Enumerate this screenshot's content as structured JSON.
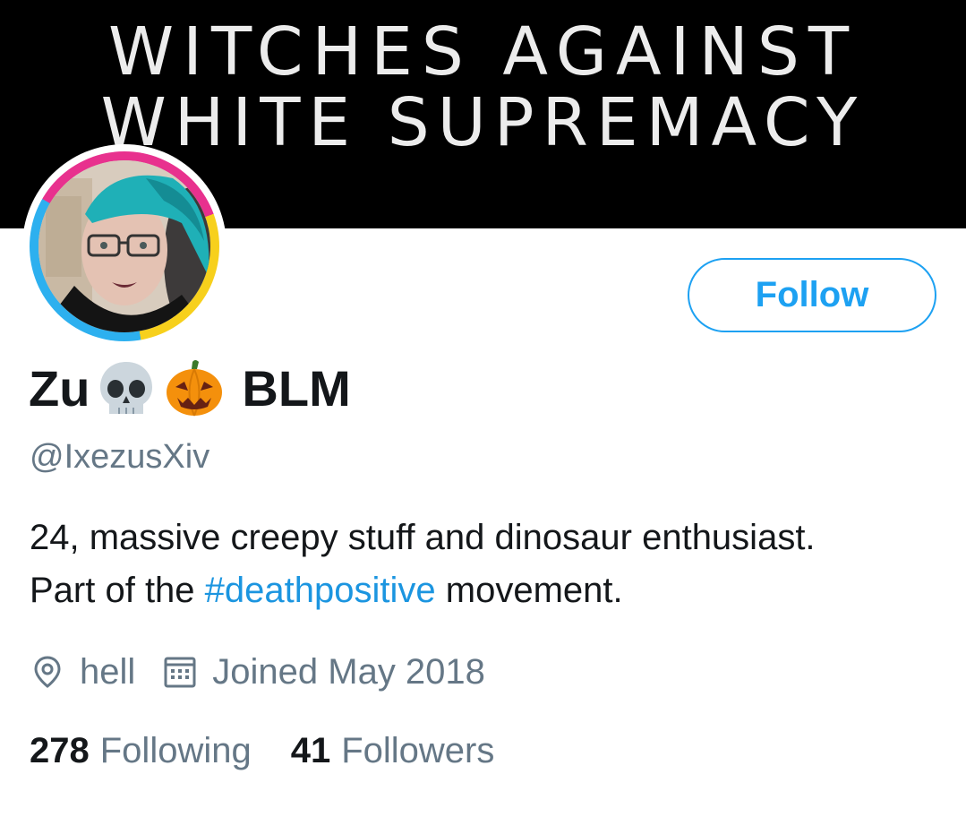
{
  "banner": {
    "line1": "WITCHES AGAINST",
    "line2": "WHITE SUPREMACY"
  },
  "profile": {
    "name": "Zu",
    "name_emojis": [
      "skull-emoji",
      "jack-o-lantern-emoji"
    ],
    "name_suffix": "BLM",
    "handle": "@IxezusXiv",
    "bio": {
      "line1": "24, massive creepy stuff and dinosaur enthusiast.",
      "line2_prefix": "Part of the ",
      "hashtag": "#deathpositive",
      "line2_suffix": " movement."
    },
    "location": "hell",
    "joined": "Joined May 2018"
  },
  "stats": {
    "following_count": "278",
    "following_label": "Following",
    "followers_count": "41",
    "followers_label": "Followers"
  },
  "actions": {
    "follow_label": "Follow"
  },
  "icons": {
    "location": "location-pin-icon",
    "calendar": "calendar-icon"
  },
  "colors": {
    "accent": "#1da1f2",
    "hashtag": "#1b95e0",
    "secondary_text": "#657786",
    "primary_text": "#14171a",
    "banner_bg": "#000000",
    "avatar_ring": [
      "#e8318e",
      "#f7d01c",
      "#2db0ef"
    ]
  }
}
